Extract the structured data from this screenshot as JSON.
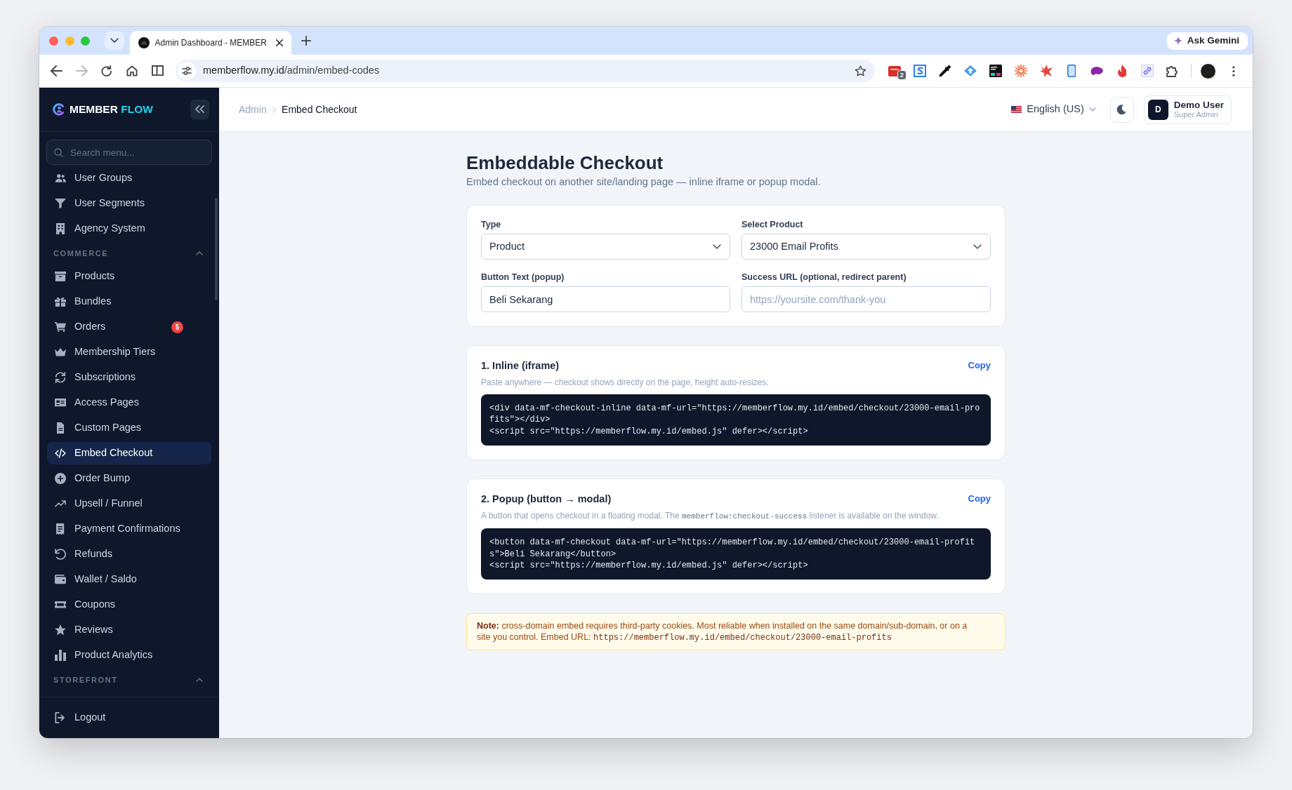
{
  "browser": {
    "tabs": [
      {
        "title": "Admin Dashboard - MEMBER",
        "selected": true
      }
    ],
    "ask_gemini": "Ask Gemini",
    "forward_disabled": true,
    "address": {
      "host": "memberflow.my.id",
      "path": "/admin/embed-codes"
    },
    "extension_badge": "2"
  },
  "sidebar": {
    "brand": {
      "main": "MEMBER",
      "accent": "FLOW"
    },
    "search": {
      "placeholder": "Search menu..."
    },
    "sections": [
      {
        "items": [
          {
            "label": "User Groups",
            "selected": false
          },
          {
            "label": "User Segments",
            "selected": false
          },
          {
            "label": "Agency System",
            "selected": false
          }
        ]
      },
      {
        "title": "COMMERCE",
        "expanded": true,
        "items": [
          {
            "label": "Products",
            "selected": false
          },
          {
            "label": "Bundles",
            "selected": false
          },
          {
            "label": "Orders",
            "selected": false,
            "badge": "5"
          },
          {
            "label": "Membership Tiers",
            "selected": false
          },
          {
            "label": "Subscriptions",
            "selected": false
          },
          {
            "label": "Access Pages",
            "selected": false
          },
          {
            "label": "Custom Pages",
            "selected": false
          },
          {
            "label": "Embed Checkout",
            "selected": true
          },
          {
            "label": "Order Bump",
            "selected": false
          },
          {
            "label": "Upsell / Funnel",
            "selected": false
          },
          {
            "label": "Payment Confirmations",
            "selected": false
          },
          {
            "label": "Refunds",
            "selected": false
          },
          {
            "label": "Wallet / Saldo",
            "selected": false
          },
          {
            "label": "Coupons",
            "selected": false
          },
          {
            "label": "Reviews",
            "selected": false
          },
          {
            "label": "Product Analytics",
            "selected": false
          }
        ]
      },
      {
        "title": "STOREFRONT",
        "expanded": true
      }
    ],
    "logout": "Logout"
  },
  "header": {
    "breadcrumb": [
      "Admin",
      "Embed Checkout"
    ],
    "language": "English (US)",
    "user": {
      "initial": "D",
      "name": "Demo User",
      "role": "Super Admin"
    }
  },
  "page": {
    "title": "Embeddable Checkout",
    "subtitle": "Embed checkout on another site/landing page — inline iframe or popup modal."
  },
  "form": {
    "fields": [
      {
        "kind": "select",
        "label": "Type",
        "value": "Product"
      },
      {
        "kind": "select",
        "label": "Select Product",
        "value": "23000 Email Profits"
      },
      {
        "kind": "input",
        "label": "Button Text (popup)",
        "value": "Beli Sekarang"
      },
      {
        "kind": "input",
        "label": "Success URL (optional, redirect parent)",
        "placeholder": "https://yoursite.com/thank-you"
      }
    ]
  },
  "snippets": [
    {
      "title": "1. Inline (iframe)",
      "copy": "Copy",
      "description": [
        {
          "kind": "text",
          "text": "Paste anywhere — checkout shows directly on the page, height auto-resizes."
        }
      ],
      "code": "<div data-mf-checkout-inline data-mf-url=\"https://memberflow.my.id/embed/checkout/23000-email-profits\"></div>\n<script src=\"https://memberflow.my.id/embed.js\" defer></script>"
    },
    {
      "title": "2. Popup (button → modal)",
      "copy": "Copy",
      "description": [
        {
          "kind": "text",
          "text": "A button that opens checkout in a floating modal. The "
        },
        {
          "kind": "code",
          "text": "memberflow:checkout-success"
        },
        {
          "kind": "text",
          "text": " listener is available on the window."
        }
      ],
      "code": "<button data-mf-checkout data-mf-url=\"https://memberflow.my.id/embed/checkout/23000-email-profits\">Beli Sekarang</button>\n<script src=\"https://memberflow.my.id/embed.js\" defer></script>"
    }
  ],
  "note": {
    "segments": [
      {
        "kind": "bold",
        "text": "Note:"
      },
      {
        "kind": "text",
        "text": " cross-domain embed requires third-party cookies. Most reliable when installed on the same domain/sub-domain, or on a site you control. Embed URL: "
      },
      {
        "kind": "code",
        "text": "https://memberflow.my.id/embed/checkout/23000-email-profits"
      }
    ]
  }
}
